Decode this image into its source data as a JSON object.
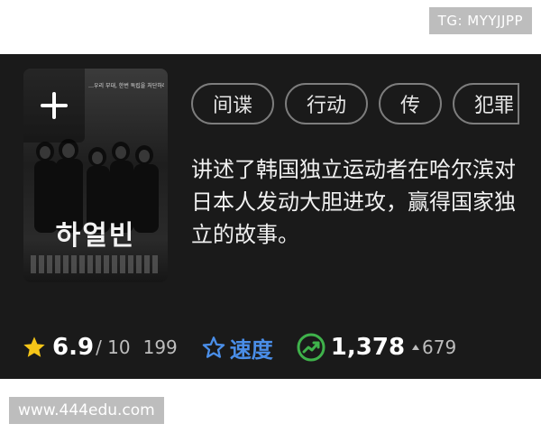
{
  "watermarks": {
    "top_right": "TG: MYYJJPP",
    "bottom_left": "www.444edu.com"
  },
  "poster": {
    "add_icon": "plus-icon",
    "tagline": "…우리 부대, 한번 독립을 처단하러",
    "title": "하얼빈"
  },
  "tags": [
    "间谍",
    "行动",
    "传",
    "犯罪"
  ],
  "description": "讲述了韩国独立运动者在哈尔滨对日本人发动大胆进攻，赢得国家独立的故事。",
  "stats": {
    "rating_icon": "star-icon",
    "rating": "6.9",
    "rating_max": "/ 10",
    "rating_count": "199",
    "speed_icon": "star-outline-icon",
    "speed_label": "速度",
    "trend_icon": "trending-up-icon",
    "views": "1,378",
    "delta": "679"
  },
  "colors": {
    "card_bg": "#1a1a1a",
    "star": "#f5c518",
    "speed_blue": "#4a8ee8",
    "trend_green": "#3fb24b",
    "watermark_bg": "#bdbdbd"
  }
}
